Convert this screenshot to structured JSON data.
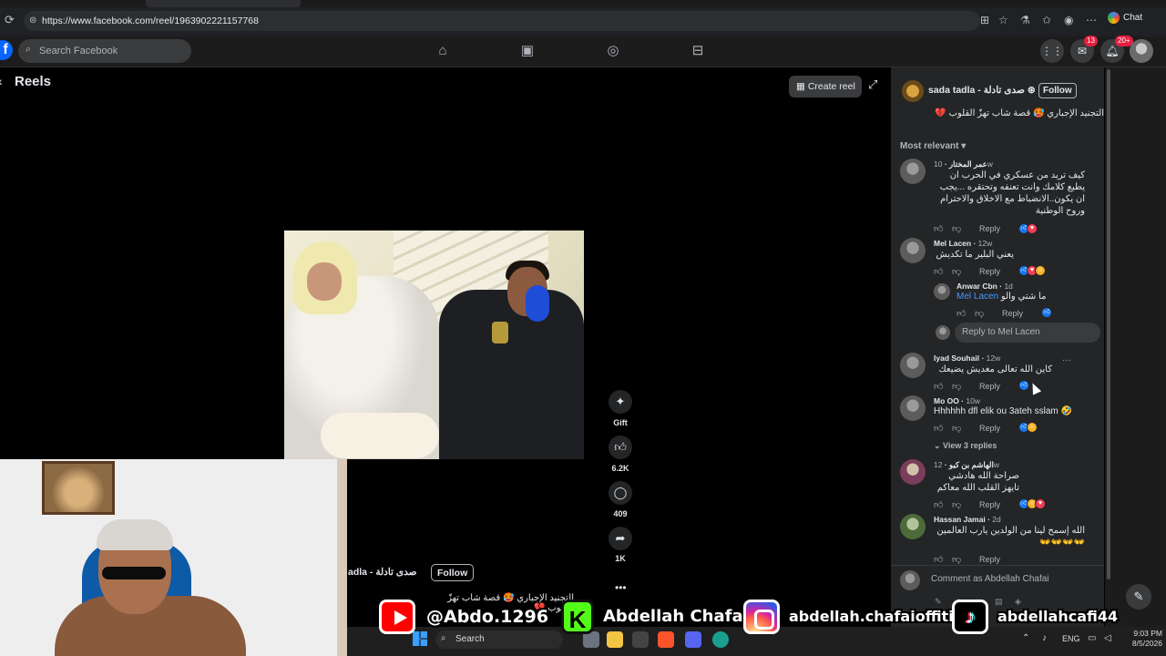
{
  "browser": {
    "url": "https://www.facebook.com/reel/1963902221157768",
    "chat_label": "Chat"
  },
  "fb_nav": {
    "logo": "f",
    "search_placeholder": "Search Facebook",
    "messenger_badge": "13",
    "notifications_badge": "20+"
  },
  "reels": {
    "title": "Reels",
    "create_reel": "Create reel",
    "actions": {
      "gift": "Gift",
      "likes": "6.2K",
      "comments": "409",
      "shares": "1K"
    },
    "owner_short": "adla - صدى تادلة",
    "follow": "Follow",
    "caption": "التجنيد الإجباري 🥵 قصة شاب تهزّ القلوب 💔"
  },
  "panel": {
    "owner": "sada tadla - صدى تادلة",
    "follow": "Follow",
    "caption": "التجنيد الإجباري 🥵 قصة شاب تهزّ القلوب 💔",
    "sort_label": "Most relevant",
    "reply_label": "Reply",
    "view_replies": "View 3 replies",
    "reply_to": "Reply to Mel Lacen",
    "comment_as": "Comment as Abdellah Chafai",
    "comments": [
      {
        "name": "عمر المختار",
        "time": "10w",
        "text": "كيف تريد من عسكري في الحرب ان يطيع كلامك وانت تعنفه وتحتقره ...يجب ان يكون..الانضباط مع الاخلاق والاحترام وروح الوطنية"
      },
      {
        "name": "Mel Lacen",
        "time": "12w",
        "text": "يعني البلير ما تكديش"
      },
      {
        "name": "Anwar Cbn",
        "time": "1d",
        "mention": "Mel Lacen",
        "text": "ما شتي والو"
      },
      {
        "name": "Iyad Souhail",
        "time": "12w",
        "text": "كاين الله تعالى مغديش يضيعك"
      },
      {
        "name": "Mo OO",
        "time": "10w",
        "text": "Hhhhhh dfl elik ou 3ateh sslam 🤣"
      },
      {
        "name": "الهاشم بن كيو",
        "time": "12w",
        "text": "صراحة الله هادشي تايهز القلب الله معاكم"
      },
      {
        "name": "Hassan Jamai",
        "time": "2d",
        "text": "الله إسمح لينا من الولدين يارب العالمين 👐👐👐👐"
      }
    ]
  },
  "overlay": {
    "youtube": "@Abdo.1296",
    "kick": "Abdellah Chafai",
    "instagram": "abdellah.chafaioffitid",
    "tiktok": "abdellahcafi44",
    "kick_letter": "K",
    "tiktok_glyph": "♪"
  },
  "taskbar": {
    "search": "Search",
    "lang": "ENG",
    "time": "9:03 PM",
    "date": "8/5/2026"
  }
}
